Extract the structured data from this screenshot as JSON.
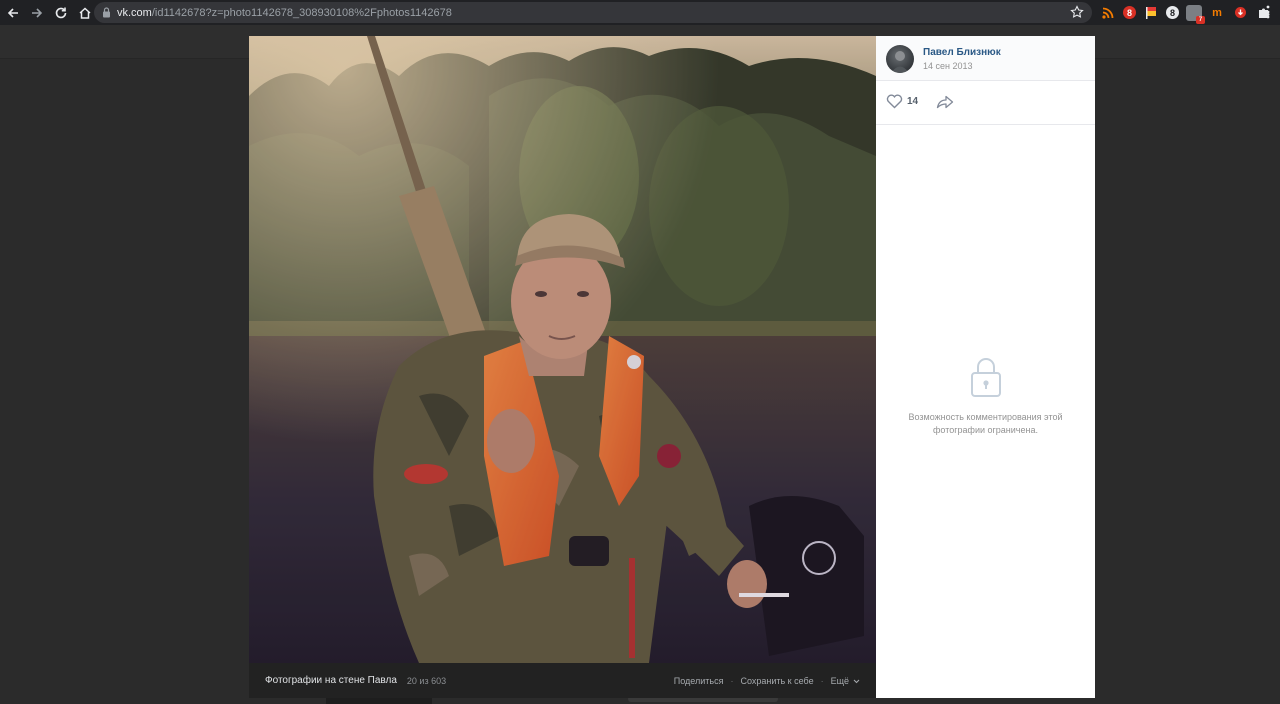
{
  "browser": {
    "url_host": "vk.com",
    "url_path": "/id1142678?z=photo1142678_308930108%2Fphotos1142678",
    "icons": [
      "back-icon",
      "forward-icon",
      "reload-icon",
      "home-icon",
      "lock-icon",
      "star-icon",
      "menu-icon"
    ],
    "extensions": [
      {
        "name": "rss-extension-icon",
        "color": "#f57c00",
        "glyph": ""
      },
      {
        "name": "red-extension-icon",
        "color": "#d93025",
        "glyph": "8"
      },
      {
        "name": "flag-extension-icon",
        "color": "#e53935",
        "glyph": ""
      },
      {
        "name": "grey-extension-icon",
        "color": "#5f6368",
        "glyph": "8"
      },
      {
        "name": "badge-extension-icon",
        "color": "#7b7f84",
        "glyph": "",
        "badge": "7"
      },
      {
        "name": "m-extension-icon",
        "color": "#202124",
        "glyph": "m"
      },
      {
        "name": "download-extension-icon",
        "color": "#202124",
        "glyph": ""
      },
      {
        "name": "puzzle-extension-icon",
        "color": "#202124",
        "glyph": ""
      }
    ]
  },
  "viewer": {
    "author_name": "Павел Близнюк",
    "date": "14 сен 2013",
    "likes": "14",
    "comments_locked_text": "Возможность комментирования этой фотографии ограничена.",
    "album_title": "Фотографии на стене Павла",
    "photo_counter": "20 из 603",
    "share_label": "Поделиться",
    "save_label": "Сохранить к себе",
    "more_label": "Ещё"
  },
  "colors": {
    "link": "#2a5885",
    "muted": "#939393",
    "page_background": "#2b2b2b"
  }
}
